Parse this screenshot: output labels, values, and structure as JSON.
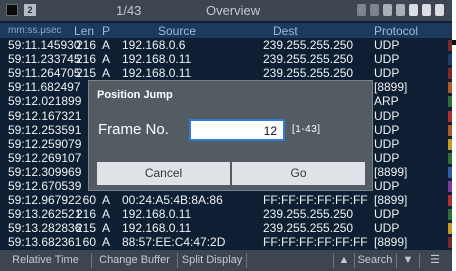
{
  "titlebar": {
    "page_indicator": "1/43",
    "title": "Overview",
    "num_icon": "2"
  },
  "columns": [
    "mm:ss.μsec",
    "Len",
    "P",
    "Source",
    "Dest",
    "Protocol"
  ],
  "rows": [
    [
      "59:11.145930",
      "216",
      "A",
      "192.168.0.6",
      "239.255.255.250",
      "UDP"
    ],
    [
      "59:11.233745",
      "216",
      "A",
      "192.168.0.11",
      "239.255.255.250",
      "UDP"
    ],
    [
      "59:11.264705",
      "215",
      "A",
      "192.168.0.11",
      "239.255.255.250",
      "UDP"
    ],
    [
      "59:11.682497",
      "",
      "",
      "",
      "",
      "[8899]"
    ],
    [
      "59:12.021899",
      "",
      "",
      "",
      "",
      "ARP"
    ],
    [
      "59:12.167321",
      "",
      "",
      "",
      "",
      "UDP"
    ],
    [
      "59:12.253591",
      "",
      "",
      "",
      "",
      "UDP"
    ],
    [
      "59:12.259079",
      "",
      "",
      "",
      "",
      "UDP"
    ],
    [
      "59:12.269107",
      "",
      "",
      "",
      "",
      "UDP"
    ],
    [
      "59:12.309969",
      "",
      "",
      "",
      "",
      "[8899]"
    ],
    [
      "59:12.670539",
      "",
      "",
      "",
      "",
      "UDP"
    ],
    [
      "59:12.967922",
      "60",
      "A",
      "00:24:A5:4B:8A:86",
      "FF:FF:FF:FF:FF:FF",
      "[8899]"
    ],
    [
      "59:13.262521",
      "216",
      "A",
      "192.168.0.11",
      "239.255.255.250",
      "UDP"
    ],
    [
      "59:13.282836",
      "215",
      "A",
      "192.168.0.11",
      "239.255.255.250",
      "UDP"
    ],
    [
      "59:13.682361",
      "60",
      "A",
      "88:57:EE:C4:47:2D",
      "FF:FF:FF:FF:FF:FF",
      "[8899]"
    ]
  ],
  "row_marker_colors": [
    "#7a2a2a",
    "#1d3d6a",
    "#7a2a2a",
    "#b05a2a",
    "#2e6e3a",
    "#b03030",
    "#b05a2a",
    "#c79a2a",
    "#2e6e3a",
    "#2f5fa0",
    "#7a3aa0",
    "#b03030",
    "#2e6e3a",
    "#c79a2a",
    "#7a2a2a"
  ],
  "dialog": {
    "title": "Position Jump",
    "label": "Frame No.",
    "value": "12",
    "range": "[1-43]",
    "cancel_label": "Cancel",
    "go_label": "Go"
  },
  "bottom_bar": {
    "relative_time": "Relative Time",
    "change_buffer": "Change Buffer",
    "split_display": "Split Display",
    "up": "▲",
    "search": "Search",
    "down": "▼",
    "menu": "☰"
  },
  "colors": {
    "background": "#0e1f33",
    "header": "#1c3a5e",
    "dialog": "#535b63",
    "input_border": "#2f7bd6"
  }
}
